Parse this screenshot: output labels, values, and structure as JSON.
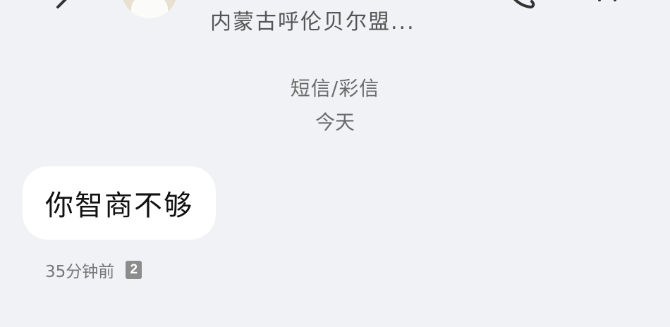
{
  "header": {
    "contact_name": "内蒙古呼伦贝尔盟...",
    "back_icon": "chevron-left-icon",
    "call_icon": "phone-icon",
    "more_icon": "more-icon"
  },
  "conversation": {
    "message_type": "短信/彩信",
    "date_label": "今天",
    "messages": [
      {
        "text": "你智商不够",
        "time": "35分钟前",
        "sim": "2"
      }
    ]
  },
  "colors": {
    "background": "#f1f2f5",
    "bubble": "#ffffff",
    "secondary_text": "#6b6b6b"
  }
}
